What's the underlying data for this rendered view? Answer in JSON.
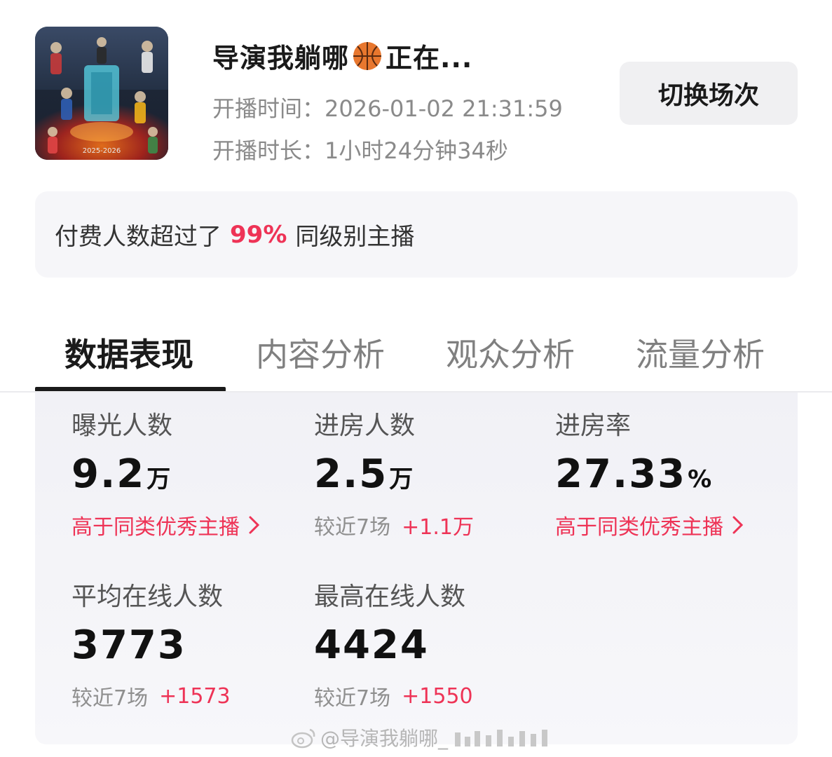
{
  "header": {
    "title_prefix": "导演我躺哪",
    "title_suffix": "正在...",
    "start_time_label": "开播时间：",
    "start_time_value": "2026-01-02 21:31:59",
    "duration_label": "开播时长：",
    "duration_value": "1小时24分钟34秒",
    "switch_button": "切换场次",
    "cover_year_text": "2025-2026"
  },
  "banner": {
    "prefix": "付费人数超过了",
    "percent": "99%",
    "suffix": "同级别主播"
  },
  "tabs": [
    {
      "label": "数据表现",
      "active": true
    },
    {
      "label": "内容分析",
      "active": false
    },
    {
      "label": "观众分析",
      "active": false
    },
    {
      "label": "流量分析",
      "active": false
    }
  ],
  "metrics": [
    {
      "label": "曝光人数",
      "value": "9.2",
      "unit": "万",
      "sub_link": "高于同类优秀主播"
    },
    {
      "label": "进房人数",
      "value": "2.5",
      "unit": "万",
      "compare_label": "较近7场",
      "compare_delta": "+1.1万"
    },
    {
      "label": "进房率",
      "value": "27.33",
      "unit": "%",
      "sub_link": "高于同类优秀主播"
    },
    {
      "label": "平均在线人数",
      "value": "3773",
      "compare_label": "较近7场",
      "compare_delta": "+1573"
    },
    {
      "label": "最高在线人数",
      "value": "4424",
      "compare_label": "较近7场",
      "compare_delta": "+1550"
    }
  ],
  "watermark": {
    "text": "@导演我躺哪_"
  },
  "colors": {
    "accent": "#ee3356",
    "text_primary": "#1a1a1a",
    "text_secondary": "#8a8a8a",
    "panel_bg": "#f4f4f8"
  }
}
